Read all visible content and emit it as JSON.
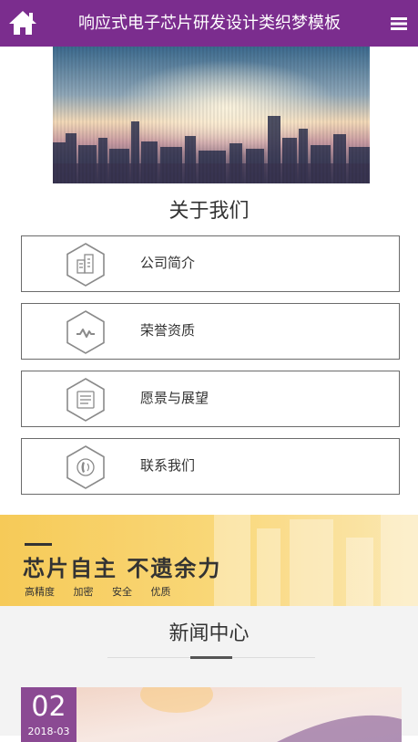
{
  "header": {
    "title": "响应式电子芯片研发设计类织梦模板",
    "home_icon": "home-icon",
    "menu_icon": "menu-icon",
    "background_color": "#7b2d8e"
  },
  "about": {
    "title": "关于我们",
    "items": [
      {
        "label": "公司简介",
        "icon": "building-icon"
      },
      {
        "label": "荣誉资质",
        "icon": "pulse-icon"
      },
      {
        "label": "愿景与展望",
        "icon": "document-icon"
      },
      {
        "label": "联系我们",
        "icon": "phone-icon"
      }
    ]
  },
  "banner": {
    "slogan": "芯片自主 不遗余力",
    "tags": [
      "高精度",
      "加密",
      "安全",
      "优质"
    ]
  },
  "news": {
    "title": "新闻中心",
    "items": [
      {
        "day": "02",
        "year_month": "2018-03"
      }
    ]
  }
}
